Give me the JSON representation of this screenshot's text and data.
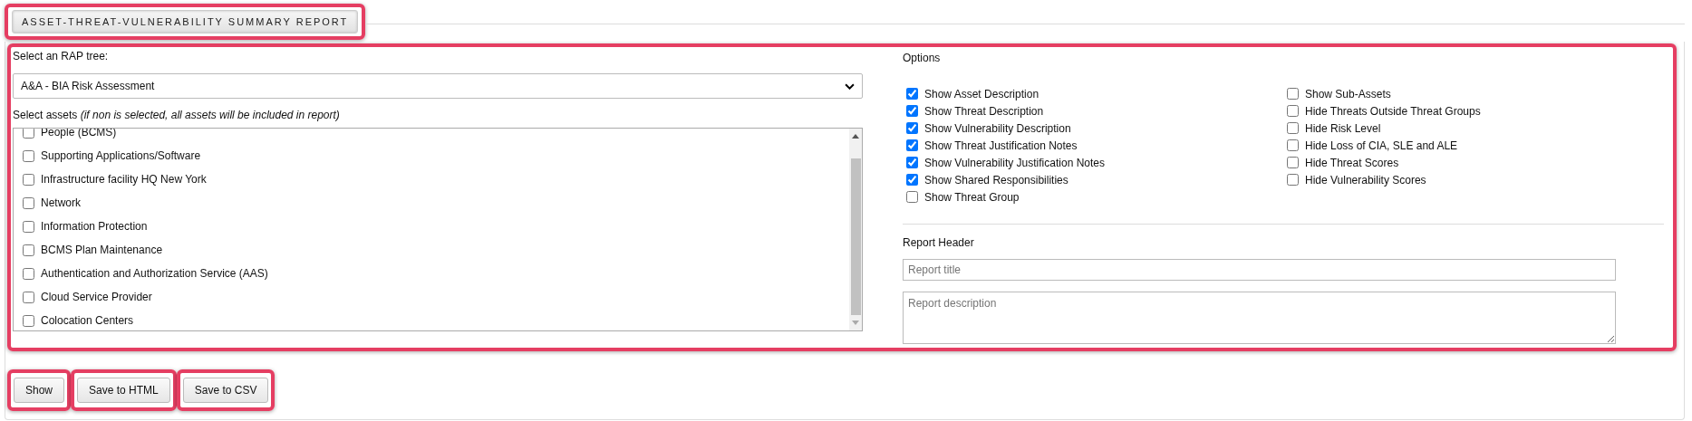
{
  "tab": {
    "label": "ASSET-THREAT-VULNERABILITY SUMMARY REPORT",
    "selected": true
  },
  "tree_select": {
    "label": "Select an RAP tree:",
    "value": "A&A - BIA Risk Assessment"
  },
  "assets": {
    "label": "Select assets",
    "hint": "(if non is selected, all assets will be included in report)",
    "items": [
      {
        "label": "People (BCMS)",
        "checked": false
      },
      {
        "label": "Supporting Applications/Software",
        "checked": false
      },
      {
        "label": "Infrastructure facility HQ New York",
        "checked": false
      },
      {
        "label": "Network",
        "checked": false
      },
      {
        "label": "Information Protection",
        "checked": false
      },
      {
        "label": "BCMS Plan Maintenance",
        "checked": false
      },
      {
        "label": "Authentication and Authorization Service (AAS)",
        "checked": false
      },
      {
        "label": "Cloud Service Provider",
        "checked": false
      },
      {
        "label": "Colocation Centers",
        "checked": false
      }
    ]
  },
  "options": {
    "title": "Options",
    "column_1": [
      {
        "label": "Show Asset Description",
        "checked": true
      },
      {
        "label": "Show Threat Description",
        "checked": true
      },
      {
        "label": "Show Vulnerability Description",
        "checked": true
      },
      {
        "label": "Show Threat Justification Notes",
        "checked": true
      },
      {
        "label": "Show Vulnerability Justification Notes",
        "checked": true
      },
      {
        "label": "Show Shared Responsibilities",
        "checked": true
      },
      {
        "label": "Show Threat Group",
        "checked": false
      }
    ],
    "column_2": [
      {
        "label": "Show Sub-Assets",
        "checked": false
      },
      {
        "label": "Hide Threats Outside Threat Groups",
        "checked": false
      },
      {
        "label": "Hide Risk Level",
        "checked": false
      },
      {
        "label": "Hide Loss of CIA, SLE and ALE",
        "checked": false
      },
      {
        "label": "Hide Threat Scores",
        "checked": false
      },
      {
        "label": "Hide Vulnerability Scores",
        "checked": false
      }
    ]
  },
  "report_header": {
    "title": "Report Header",
    "title_placeholder": "Report title",
    "description_placeholder": "Report description"
  },
  "buttons": [
    "Show",
    "Save to HTML",
    "Save to CSV"
  ]
}
